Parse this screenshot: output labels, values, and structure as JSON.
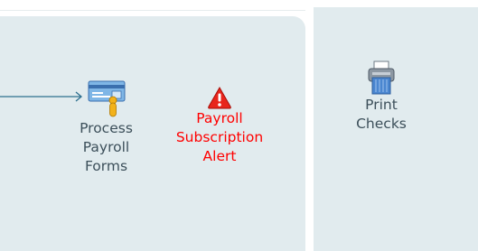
{
  "workflow": {
    "process_payroll_forms": {
      "label": "Process\nPayroll\nForms",
      "icon": "check-payment-icon"
    },
    "payroll_subscription_alert": {
      "label": "Payroll\nSubscription\nAlert",
      "icon": "warning-icon"
    },
    "print_checks": {
      "label": "Print\nChecks",
      "icon": "printer-icon"
    }
  },
  "colors": {
    "panel_bg": "#e1ebee",
    "label_text": "#3c4f5a",
    "alert_text": "#ff0000",
    "arrow": "#2d6f8f"
  }
}
